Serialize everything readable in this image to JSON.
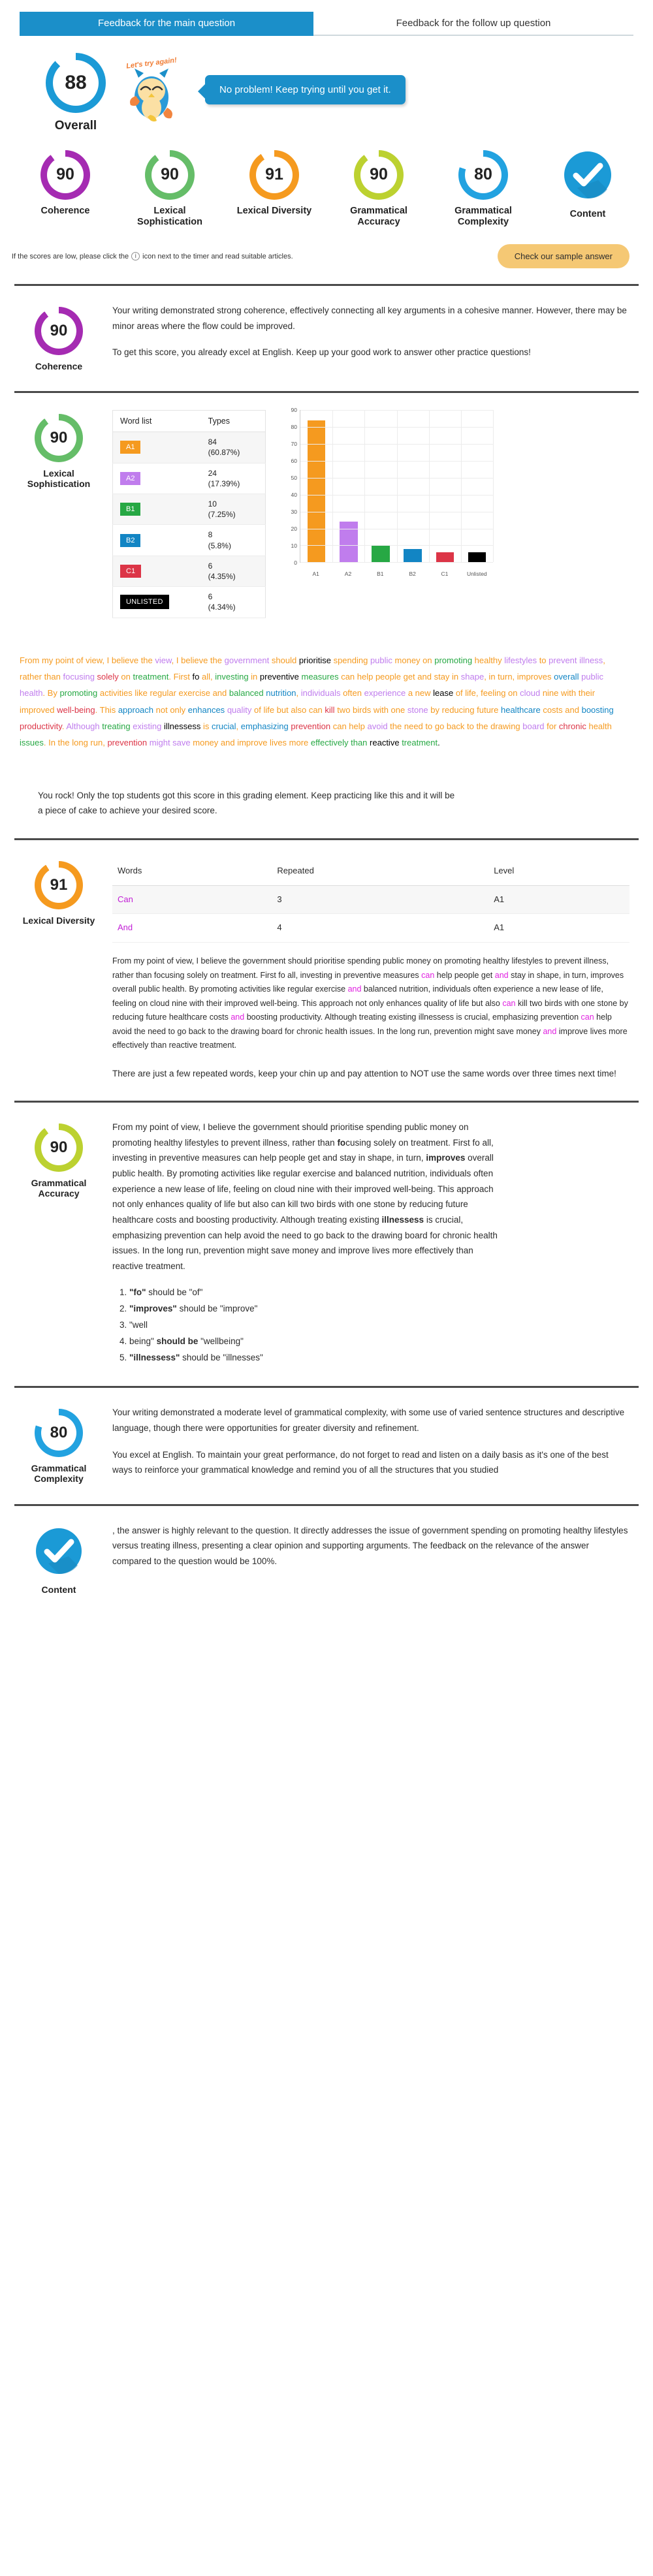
{
  "tabs": [
    {
      "label": "Feedback for the main question",
      "active": true
    },
    {
      "label": "Feedback for the follow up question",
      "active": false
    }
  ],
  "overall": {
    "score": "88",
    "label": "Overall",
    "color": "#1b9ad6",
    "percent": 88,
    "mascot_text": "Let's try again!",
    "bubble_text": "No problem! Keep trying until you get it."
  },
  "scores": [
    {
      "score": "90",
      "label": "Coherence",
      "color": "#a52bb2",
      "percent": 90,
      "check": false
    },
    {
      "score": "90",
      "label": "Lexical Sophistication",
      "color": "#65bd68",
      "percent": 90,
      "check": false
    },
    {
      "score": "91",
      "label": "Lexical Diversity",
      "color": "#f59a1f",
      "percent": 91,
      "check": false
    },
    {
      "score": "90",
      "label": "Grammatical Accuracy",
      "color": "#bcd130",
      "percent": 90,
      "check": false
    },
    {
      "score": "80",
      "label": "Grammatical Complexity",
      "color": "#22a2e0",
      "percent": 80,
      "check": false
    },
    {
      "score": "",
      "label": "Content",
      "color": "#1b9ad6",
      "percent": 100,
      "check": true
    }
  ],
  "note": {
    "text_before": "If the scores are low, please click the",
    "icon": "info-icon",
    "text_after": "icon next to the timer and read suitable articles.",
    "button_label": "Check our sample answer",
    "button_color": "#f5c874"
  },
  "coherence": {
    "score": "90",
    "label": "Coherence",
    "color": "#a52bb2",
    "percent": 90,
    "paragraphs": [
      "Your writing demonstrated strong coherence, effectively connecting all key arguments in a cohesive manner. However, there may be minor areas where the flow could be improved.",
      "To get this score, you already excel at English. Keep up your good work to answer other practice questions!"
    ]
  },
  "lexical_sophistication": {
    "score": "90",
    "label": "Lexical Sophistication",
    "color": "#65bd68",
    "percent": 90,
    "table": {
      "headers": [
        "Word list",
        "Types"
      ],
      "rows": [
        {
          "chip": "A1",
          "chip_color": "#f59a1f",
          "count": "84",
          "pct": "(60.87%)"
        },
        {
          "chip": "A2",
          "chip_color": "#c07ded",
          "count": "24",
          "pct": "(17.39%)"
        },
        {
          "chip": "B1",
          "chip_color": "#27a844",
          "count": "10",
          "pct": "(7.25%)"
        },
        {
          "chip": "B2",
          "chip_color": "#1285c4",
          "count": "8",
          "pct": "(5.8%)"
        },
        {
          "chip": "C1",
          "chip_color": "#dc3547",
          "count": "6",
          "pct": "(4.35%)"
        },
        {
          "chip": "UNLISTED",
          "chip_color": "#000000",
          "count": "6",
          "pct": "(4.34%)"
        }
      ]
    },
    "feedback": "You rock! Only the top students got this score in this grading element. Keep practicing like this and it will be a piece of cake to achieve your desired score."
  },
  "chart_data": {
    "type": "bar",
    "title": "",
    "xlabel": "",
    "ylabel": "",
    "categories": [
      "A1",
      "A2",
      "B1",
      "B2",
      "C1",
      "Unlisted"
    ],
    "values": [
      84,
      24,
      10,
      8,
      6,
      6
    ],
    "colors": [
      "#f59a1f",
      "#c07ded",
      "#27a844",
      "#1285c4",
      "#dc3547",
      "#000000"
    ],
    "ylim": [
      0,
      90
    ],
    "yticks": [
      0,
      10,
      20,
      30,
      40,
      50,
      60,
      70,
      80,
      90
    ],
    "grid": true,
    "legend": false
  },
  "colored_essay": [
    {
      "t": "From my point of view, ",
      "c": "#f59a1f"
    },
    {
      "t": "I believe the ",
      "c": "#f59a1f"
    },
    {
      "t": "view",
      "c": "#c07ded"
    },
    {
      "t": ", I believe the ",
      "c": "#f59a1f"
    },
    {
      "t": "government",
      "c": "#c07ded"
    },
    {
      "t": " should ",
      "c": "#f59a1f"
    },
    {
      "t": "prioritise",
      "c": "#000000"
    },
    {
      "t": " spending ",
      "c": "#f59a1f"
    },
    {
      "t": "public",
      "c": "#c07ded"
    },
    {
      "t": " money on ",
      "c": "#f59a1f"
    },
    {
      "t": "promoting",
      "c": "#27a844"
    },
    {
      "t": " healthy ",
      "c": "#f59a1f"
    },
    {
      "t": "lifestyles",
      "c": "#c07ded"
    },
    {
      "t": " to ",
      "c": "#f59a1f"
    },
    {
      "t": "prevent illness",
      "c": "#c07ded"
    },
    {
      "t": ", rather than ",
      "c": "#f59a1f"
    },
    {
      "t": "focusing",
      "c": "#c07ded"
    },
    {
      "t": " ",
      "c": "#f59a1f"
    },
    {
      "t": "solely",
      "c": "#dc3547"
    },
    {
      "t": " on ",
      "c": "#f59a1f"
    },
    {
      "t": "treatment",
      "c": "#27a844"
    },
    {
      "t": ". First ",
      "c": "#f59a1f"
    },
    {
      "t": "fo",
      "c": "#000000"
    },
    {
      "t": " ",
      "c": "#f59a1f"
    },
    {
      "t": "all",
      "c": "#f59a1f"
    },
    {
      "t": ", ",
      "c": "#f59a1f"
    },
    {
      "t": "investing",
      "c": "#27a844"
    },
    {
      "t": " in ",
      "c": "#f59a1f"
    },
    {
      "t": "preventive",
      "c": "#000000"
    },
    {
      "t": " ",
      "c": "#f59a1f"
    },
    {
      "t": "measures",
      "c": "#27a844"
    },
    {
      "t": " can help people get and stay in ",
      "c": "#f59a1f"
    },
    {
      "t": "shape",
      "c": "#c07ded"
    },
    {
      "t": ", in turn, ",
      "c": "#f59a1f"
    },
    {
      "t": "improves",
      "c": "#f59a1f"
    },
    {
      "t": " ",
      "c": "#f59a1f"
    },
    {
      "t": "overall",
      "c": "#1285c4"
    },
    {
      "t": " ",
      "c": "#f59a1f"
    },
    {
      "t": "public health",
      "c": "#c07ded"
    },
    {
      "t": ". By ",
      "c": "#f59a1f"
    },
    {
      "t": "promoting",
      "c": "#27a844"
    },
    {
      "t": " activities like ",
      "c": "#f59a1f"
    },
    {
      "t": "regular exercise",
      "c": "#f59a1f"
    },
    {
      "t": " and ",
      "c": "#f59a1f"
    },
    {
      "t": "balanced",
      "c": "#27a844"
    },
    {
      "t": " ",
      "c": "#f59a1f"
    },
    {
      "t": "nutrition",
      "c": "#1285c4"
    },
    {
      "t": ", ",
      "c": "#f59a1f"
    },
    {
      "t": "individuals",
      "c": "#c07ded"
    },
    {
      "t": " often ",
      "c": "#f59a1f"
    },
    {
      "t": "experience",
      "c": "#c07ded"
    },
    {
      "t": " a new ",
      "c": "#f59a1f"
    },
    {
      "t": "lease",
      "c": "#000000"
    },
    {
      "t": " of life",
      "c": "#f59a1f"
    },
    {
      "t": ", feeling on ",
      "c": "#f59a1f"
    },
    {
      "t": "cloud",
      "c": "#c07ded"
    },
    {
      "t": " nine with their ",
      "c": "#f59a1f"
    },
    {
      "t": "improved",
      "c": "#f59a1f"
    },
    {
      "t": " ",
      "c": "#f59a1f"
    },
    {
      "t": "well-being",
      "c": "#dc3547"
    },
    {
      "t": ". This ",
      "c": "#f59a1f"
    },
    {
      "t": "approach",
      "c": "#1285c4"
    },
    {
      "t": " not only ",
      "c": "#f59a1f"
    },
    {
      "t": "enhances",
      "c": "#1285c4"
    },
    {
      "t": " ",
      "c": "#f59a1f"
    },
    {
      "t": "quality",
      "c": "#c07ded"
    },
    {
      "t": " of life but also can ",
      "c": "#f59a1f"
    },
    {
      "t": "kill",
      "c": "#dc3547"
    },
    {
      "t": " two birds with one ",
      "c": "#f59a1f"
    },
    {
      "t": "stone",
      "c": "#c07ded"
    },
    {
      "t": " by ",
      "c": "#f59a1f"
    },
    {
      "t": "reducing",
      "c": "#f59a1f"
    },
    {
      "t": " future ",
      "c": "#f59a1f"
    },
    {
      "t": "healthcare",
      "c": "#1285c4"
    },
    {
      "t": " ",
      "c": "#f59a1f"
    },
    {
      "t": "costs",
      "c": "#f59a1f"
    },
    {
      "t": " and ",
      "c": "#f59a1f"
    },
    {
      "t": "boosting",
      "c": "#1285c4"
    },
    {
      "t": " ",
      "c": "#f59a1f"
    },
    {
      "t": "productivity",
      "c": "#dc3547"
    },
    {
      "t": ". ",
      "c": "#f59a1f"
    },
    {
      "t": "Although",
      "c": "#c07ded"
    },
    {
      "t": " ",
      "c": "#f59a1f"
    },
    {
      "t": "treating",
      "c": "#27a844"
    },
    {
      "t": " ",
      "c": "#f59a1f"
    },
    {
      "t": "existing",
      "c": "#c07ded"
    },
    {
      "t": " ",
      "c": "#f59a1f"
    },
    {
      "t": "illnessess",
      "c": "#000000"
    },
    {
      "t": " is ",
      "c": "#f59a1f"
    },
    {
      "t": "crucial",
      "c": "#1285c4"
    },
    {
      "t": ", ",
      "c": "#f59a1f"
    },
    {
      "t": "emphasizing",
      "c": "#1285c4"
    },
    {
      "t": " ",
      "c": "#f59a1f"
    },
    {
      "t": "prevention",
      "c": "#dc3547"
    },
    {
      "t": " can help ",
      "c": "#f59a1f"
    },
    {
      "t": "avoid",
      "c": "#c07ded"
    },
    {
      "t": " the need to go back to the drawing ",
      "c": "#f59a1f"
    },
    {
      "t": "board",
      "c": "#c07ded"
    },
    {
      "t": " for ",
      "c": "#f59a1f"
    },
    {
      "t": "chronic",
      "c": "#dc3547"
    },
    {
      "t": " ",
      "c": "#f59a1f"
    },
    {
      "t": "health",
      "c": "#f59a1f"
    },
    {
      "t": " ",
      "c": "#f59a1f"
    },
    {
      "t": "issues",
      "c": "#27a844"
    },
    {
      "t": ". In the long run",
      "c": "#f59a1f"
    },
    {
      "t": ", ",
      "c": "#f59a1f"
    },
    {
      "t": "prevention",
      "c": "#dc3547"
    },
    {
      "t": " ",
      "c": "#f59a1f"
    },
    {
      "t": "might save",
      "c": "#c07ded"
    },
    {
      "t": " money and ",
      "c": "#f59a1f"
    },
    {
      "t": "improve lives more",
      "c": "#f59a1f"
    },
    {
      "t": " ",
      "c": "#f59a1f"
    },
    {
      "t": "effectively than",
      "c": "#27a844"
    },
    {
      "t": " ",
      "c": "#f59a1f"
    },
    {
      "t": "reactive",
      "c": "#000000"
    },
    {
      "t": " ",
      "c": "#f59a1f"
    },
    {
      "t": "treatment",
      "c": "#27a844"
    },
    {
      "t": ".",
      "c": "#000000"
    }
  ],
  "lexical_diversity": {
    "score": "91",
    "label": "Lexical Diversity",
    "color": "#f59a1f",
    "percent": 91,
    "table": {
      "headers": [
        "Words",
        "Repeated",
        "Level"
      ],
      "rows": [
        {
          "word": "Can",
          "repeated": "3",
          "level": "A1"
        },
        {
          "word": "And",
          "repeated": "4",
          "level": "A1"
        }
      ]
    },
    "essay_parts": [
      {
        "t": "From my point of view, I believe the government should prioritise spending public money on promoting healthy lifestyles to prevent illness, rather than focusing solely on treatment. First fo all, investing in preventive measures ",
        "hl": false
      },
      {
        "t": "can",
        "hl": true
      },
      {
        "t": " help people get ",
        "hl": false
      },
      {
        "t": "and",
        "hl": true
      },
      {
        "t": " stay in shape, in turn, improves overall public health. By promoting activities like regular exercise ",
        "hl": false
      },
      {
        "t": "and",
        "hl": true
      },
      {
        "t": " balanced nutrition, individuals often experience a new lease of life, feeling on cloud nine with their improved well-being. This approach not only enhances quality of life but also ",
        "hl": false
      },
      {
        "t": "can",
        "hl": true
      },
      {
        "t": " kill two birds with one stone by reducing future healthcare costs ",
        "hl": false
      },
      {
        "t": "and",
        "hl": true
      },
      {
        "t": " boosting productivity. Although treating existing illnessess is crucial, emphasizing prevention ",
        "hl": false
      },
      {
        "t": "can",
        "hl": true
      },
      {
        "t": " help avoid the need to go back to the drawing board for chronic health issues. In the long run, prevention might save money ",
        "hl": false
      },
      {
        "t": "and",
        "hl": true
      },
      {
        "t": " improve lives more effectively than reactive treatment.",
        "hl": false
      }
    ],
    "feedback": "There are just a few repeated words, keep your chin up and pay attention to NOT use the same words over three times next time!"
  },
  "grammatical_accuracy": {
    "score": "90",
    "label": "Grammatical Accuracy",
    "color": "#bcd130",
    "percent": 90,
    "essay_parts": [
      {
        "t": "From my point of view, I believe the government should prioritise spending public money on promoting healthy lifestyles to prevent illness, rather than ",
        "b": false
      },
      {
        "t": "fo",
        "b": true
      },
      {
        "t": "cusing solely on treatment. First fo all, investing in preventive measures can help people get and stay in shape, in turn, ",
        "b": false
      },
      {
        "t": "improves",
        "b": true
      },
      {
        "t": " overall public health. By promoting activities like regular exercise and balanced nutrition, individuals often experience a new lease of life, feeling on cloud nine with their improved well-being. This approach not only enhances quality of life but also can kill two birds with one stone by reducing future healthcare costs and boosting productivity. Although treating existing ",
        "b": false
      },
      {
        "t": "illnessess",
        "b": true
      },
      {
        "t": " is crucial, emphasizing prevention can help avoid the need to go back to the drawing board for chronic health issues. In the long run, prevention might save money and improve lives more effectively than reactive treatment.",
        "b": false
      }
    ],
    "fixes": [
      [
        {
          "t": "\"fo\"",
          "b": true
        },
        {
          "t": " should be \"of\"",
          "b": false
        }
      ],
      [
        {
          "t": "\"improves\"",
          "b": true
        },
        {
          "t": " should be \"improve\"",
          "b": false
        }
      ],
      [
        {
          "t": "\"well",
          "b": false
        }
      ],
      [
        {
          "t": "being\" ",
          "b": false
        },
        {
          "t": "should be",
          "b": true
        },
        {
          "t": " \"wellbeing\"",
          "b": false
        }
      ],
      [
        {
          "t": "\"illnessess\"",
          "b": true
        },
        {
          "t": " should be \"illnesses\"",
          "b": false
        }
      ]
    ]
  },
  "grammatical_complexity": {
    "score": "80",
    "label": "Grammatical Complexity",
    "color": "#22a2e0",
    "percent": 80,
    "paragraphs": [
      "Your writing demonstrated a moderate level of grammatical complexity, with some use of varied sentence structures and descriptive language, though there were opportunities for greater diversity and refinement.",
      "You excel at English. To maintain your great performance, do not forget to read and listen on a daily basis as it's one of the best ways to reinforce your grammatical knowledge and remind you of all the structures that you studied"
    ]
  },
  "content": {
    "score": "",
    "label": "Content",
    "color": "#1b9ad6",
    "percent": 100,
    "check_icon": "check-circle-icon",
    "paragraphs": [
      ", the answer is highly relevant to the question. It directly addresses the issue of government spending on promoting healthy lifestyles versus treating illness, presenting a clear opinion and supporting arguments. The feedback on the relevance of the answer compared to the question would be 100%."
    ]
  }
}
